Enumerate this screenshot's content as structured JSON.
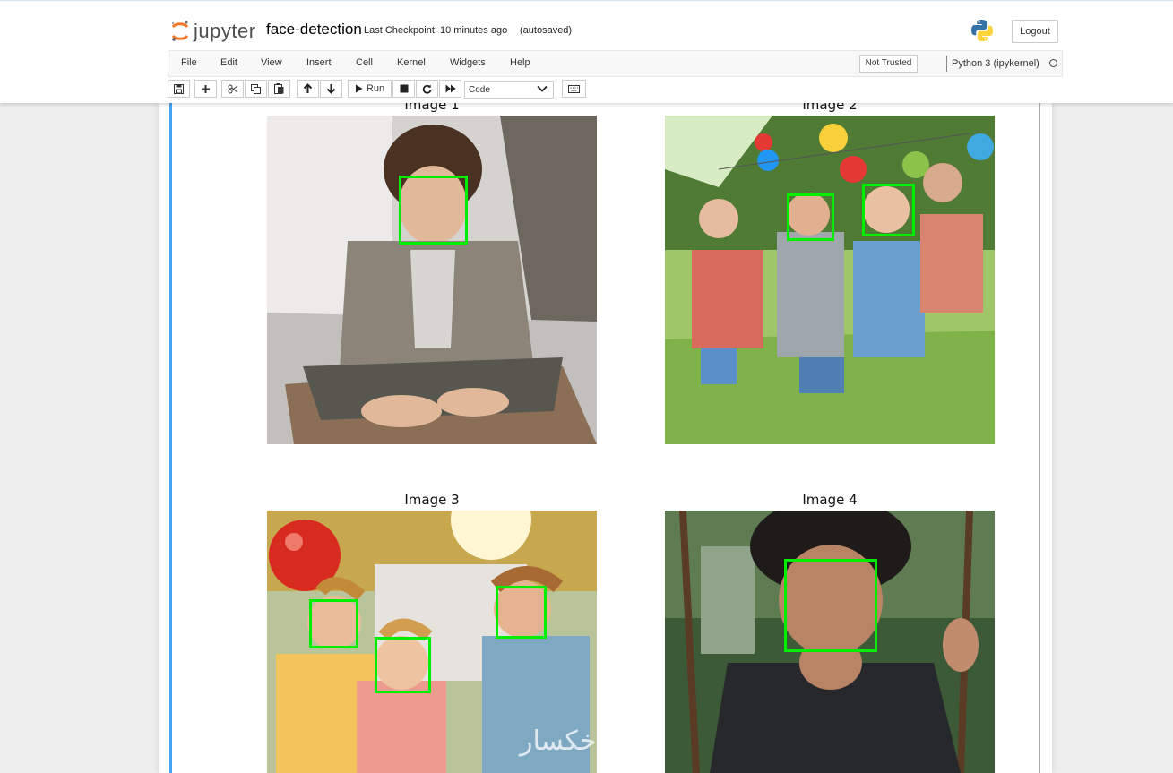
{
  "header": {
    "logo_text": "jupyter",
    "notebook_name": "face-detection",
    "checkpoint": "Last Checkpoint: 10 minutes ago",
    "autosave_status": "(autosaved)",
    "logout_label": "Logout"
  },
  "menubar": {
    "items": [
      "File",
      "Edit",
      "View",
      "Insert",
      "Cell",
      "Kernel",
      "Widgets",
      "Help"
    ],
    "trust_label": "Not Trusted",
    "kernel_name": "Python 3 (ipykernel)"
  },
  "toolbar": {
    "run_label": "Run",
    "cell_type": "Code"
  },
  "output": {
    "images": [
      {
        "title": "Image 1",
        "faces_detected": 1
      },
      {
        "title": "Image 2",
        "faces_detected": 2
      },
      {
        "title": "Image 3",
        "faces_detected": 3
      },
      {
        "title": "Image 4",
        "faces_detected": 1
      }
    ],
    "watermark": "خكسار"
  },
  "colors": {
    "detection_box": "#00ee00",
    "landmark_dot": "#3030ff",
    "cell_selected_bar": "#42a5f5",
    "jupyter_orange": "#f37626"
  }
}
